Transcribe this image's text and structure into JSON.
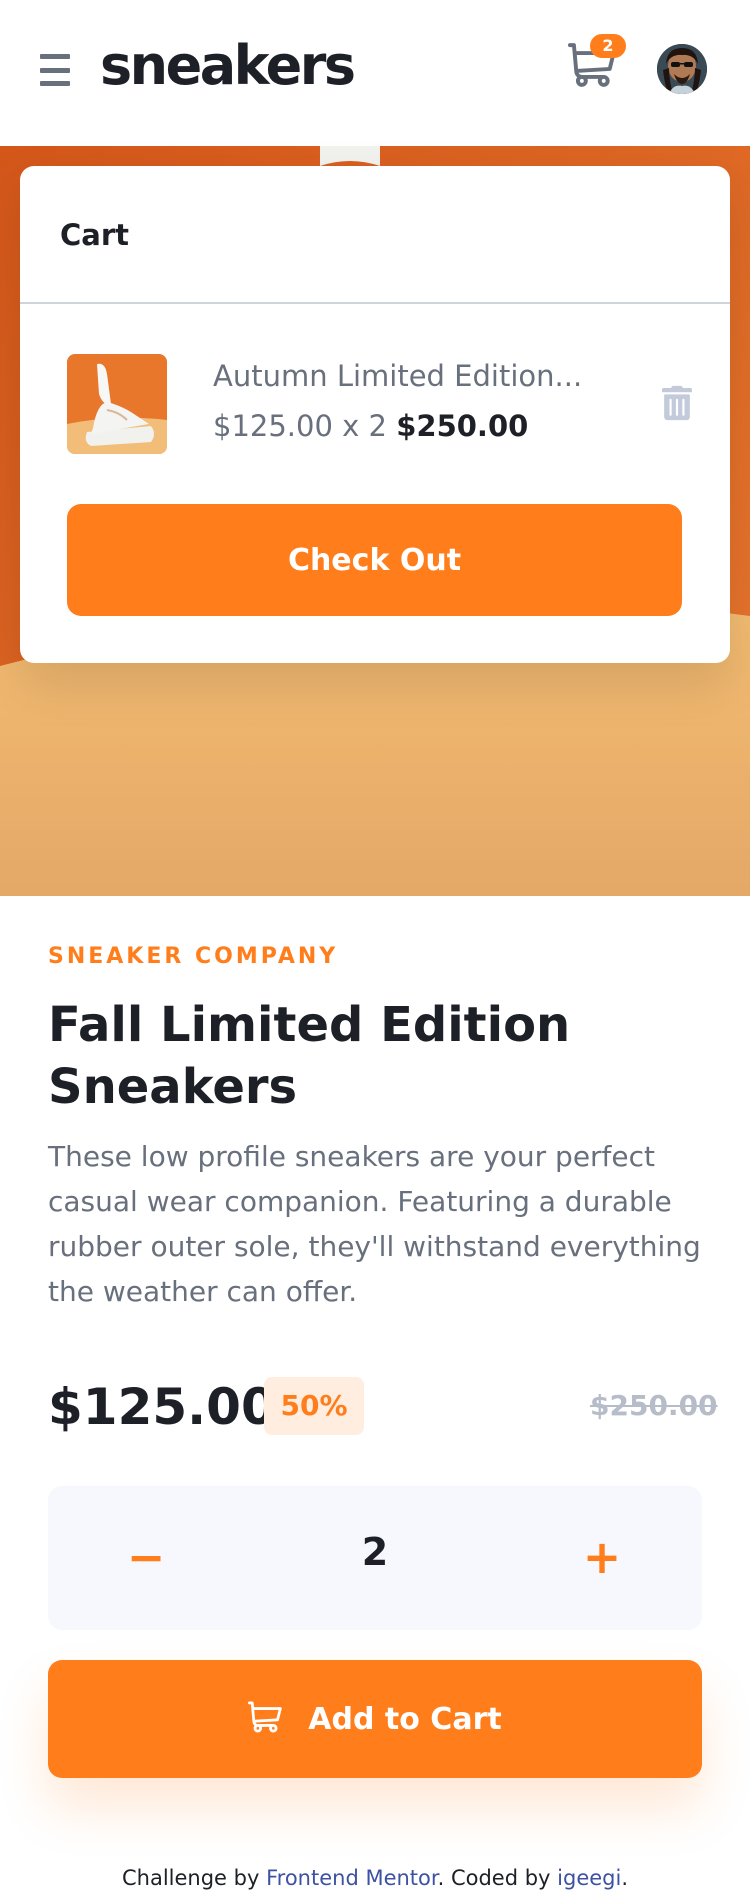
{
  "header": {
    "logo": "sneakers",
    "cart_count": "2"
  },
  "cart": {
    "title": "Cart",
    "item": {
      "name": "Autumn Limited Edition...",
      "unit_price": "$125.00",
      "times": "x",
      "quantity": "2",
      "total": "$250.00"
    },
    "checkout_label": "Check Out"
  },
  "product": {
    "company": "SNEAKER COMPANY",
    "title": "Fall Limited Edition Sneakers",
    "description": "These low profile sneakers are your perfect casual wear companion. Featuring a durable rubber outer sole, they'll withstand everything the weather can offer.",
    "price": "$125.00",
    "discount": "50%",
    "original_price": "$250.00"
  },
  "quantity": {
    "minus": "−",
    "value": "2",
    "plus": "+"
  },
  "add_to_cart_label": "Add to Cart",
  "footer": {
    "prefix": "Challenge by ",
    "link1": "Frontend Mentor",
    "middle": ". Coded by ",
    "link2": "igeegi",
    "suffix": "."
  },
  "colors": {
    "accent": "#ff7e1b",
    "accent_pale": "#ffede0",
    "dark": "#1d2026",
    "grey": "#69707d",
    "light_bg": "#f6f8fd"
  }
}
